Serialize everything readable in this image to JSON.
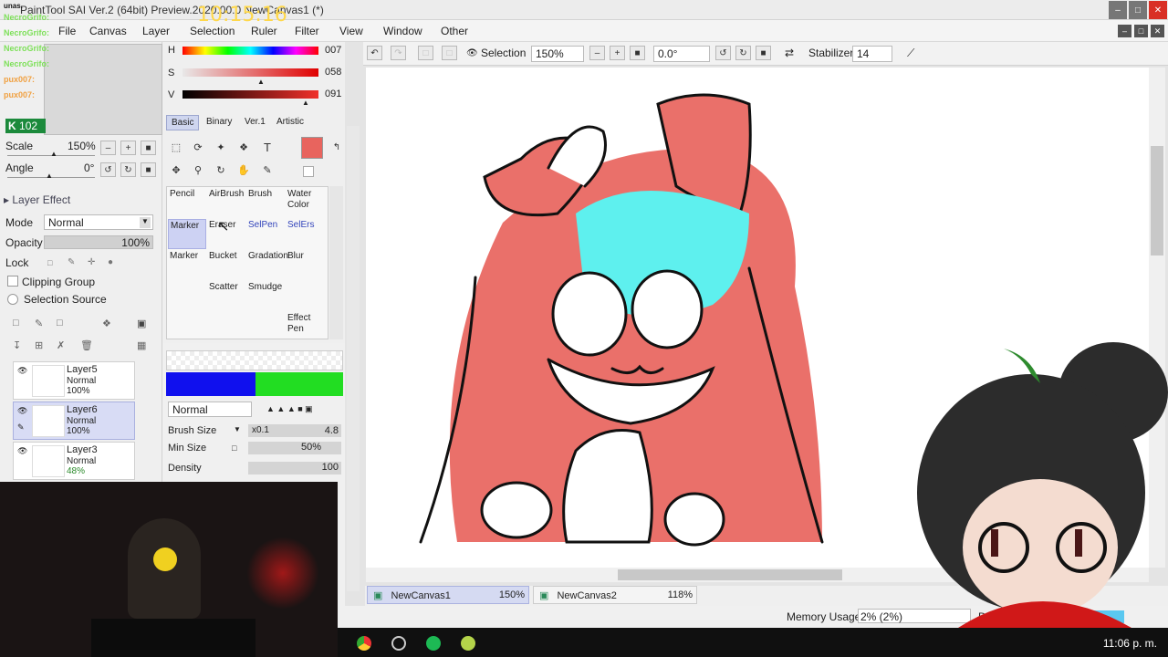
{
  "window": {
    "title": "PaintTool SAI Ver.2 (64bit) Preview.2020.00.0 NewCanvas1 (*)"
  },
  "overlay": {
    "clock": "10:15:16",
    "counter": "102",
    "chat": [
      {
        "user": "NecroGrifo:",
        "color": "#7ee05a"
      },
      {
        "user": "NecroGrifo:",
        "color": "#7ee05a"
      },
      {
        "user": "NecroGrifo:",
        "color": "#7ee05a"
      },
      {
        "user": "NecroGrifo:",
        "color": "#7ee05a"
      },
      {
        "user": "pux007:",
        "color": "#f0a040"
      },
      {
        "user": "pux007:",
        "color": "#f0a040"
      }
    ],
    "partial_top": "unas."
  },
  "menu": [
    "File",
    "Canvas",
    "Layer",
    "Selection",
    "Ruler",
    "Filter",
    "View",
    "Window",
    "Other"
  ],
  "navigator": {
    "scale_label": "Scale",
    "scale_value": "150%",
    "angle_label": "Angle",
    "angle_value": "0°"
  },
  "layer_effect": {
    "header": "Layer Effect",
    "mode_label": "Mode",
    "mode_value": "Normal",
    "opacity_label": "Opacity",
    "opacity_value": "100%",
    "lock_label": "Lock",
    "clipping_group": "Clipping Group",
    "selection_source": "Selection Source"
  },
  "layers": [
    {
      "name": "Layer5",
      "mode": "Normal",
      "opacity": "100%"
    },
    {
      "name": "Layer6",
      "mode": "Normal",
      "opacity": "100%"
    },
    {
      "name": "Layer3",
      "mode": "Normal",
      "opacity": "48%"
    }
  ],
  "color": {
    "h_label": "H",
    "h_value": "007",
    "s_label": "S",
    "s_value": "058",
    "v_label": "V",
    "v_value": "091",
    "current": "#e8645e"
  },
  "color_tabs": [
    "Basic",
    "Binary",
    "Ver.1",
    "Artistic"
  ],
  "brushes": [
    {
      "name": "Pencil"
    },
    {
      "name": "AirBrush"
    },
    {
      "name": "Brush"
    },
    {
      "name": "Water Color"
    },
    {
      "name": "Marker"
    },
    {
      "name": "Eraser"
    },
    {
      "name": "SelPen"
    },
    {
      "name": "SelErs"
    },
    {
      "name": "Marker"
    },
    {
      "name": "Bucket"
    },
    {
      "name": "Gradation"
    },
    {
      "name": "Blur"
    },
    {
      "name": ""
    },
    {
      "name": "Scatter"
    },
    {
      "name": "Smudge"
    },
    {
      "name": ""
    },
    {
      "name": ""
    },
    {
      "name": ""
    },
    {
      "name": ""
    },
    {
      "name": "Effect Pen"
    }
  ],
  "brush_props": {
    "blend_mode": "Normal",
    "size_label": "Brush Size",
    "size_mult": "x0.1",
    "size_value": "4.8",
    "min_size_label": "Min Size",
    "min_size_value": "50%",
    "density_label": "Density",
    "density_value": "100"
  },
  "canvas_toolbar": {
    "selection_label": "Selection",
    "zoom": "150%",
    "rotation": "0.0°",
    "stabilizer_label": "Stabilizer",
    "stabilizer_value": "14"
  },
  "doc_tabs": [
    {
      "name": "NewCanvas1",
      "zoom": "150%"
    },
    {
      "name": "NewCanvas2",
      "zoom": "118%"
    }
  ],
  "status": {
    "memory_label": "Memory Usage",
    "memory_value": "2% (2%)",
    "drive_label": "Driv"
  },
  "taskbar": {
    "time": "11:06 p. m."
  }
}
